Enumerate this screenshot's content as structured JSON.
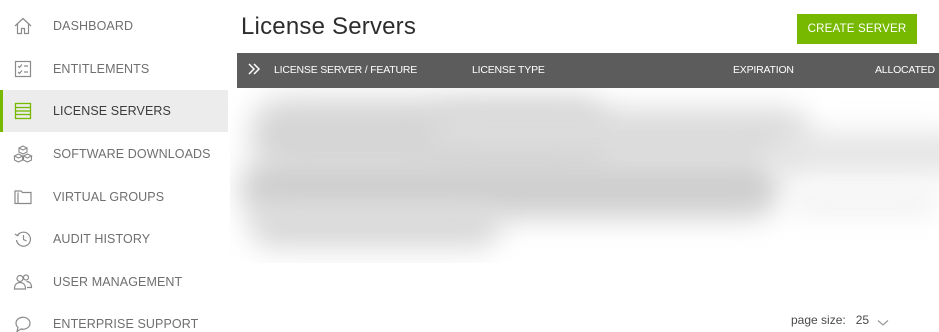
{
  "sidebar": {
    "items": [
      {
        "label": "DASHBOARD",
        "icon": "home-icon"
      },
      {
        "label": "ENTITLEMENTS",
        "icon": "checklist-icon"
      },
      {
        "label": "LICENSE SERVERS",
        "icon": "server-list-icon",
        "active": true
      },
      {
        "label": "SOFTWARE DOWNLOADS",
        "icon": "boxes-icon"
      },
      {
        "label": "VIRTUAL GROUPS",
        "icon": "folder-icon"
      },
      {
        "label": "AUDIT HISTORY",
        "icon": "history-icon"
      },
      {
        "label": "USER MANAGEMENT",
        "icon": "users-icon"
      },
      {
        "label": "ENTERPRISE SUPPORT",
        "icon": "support-chat-icon"
      }
    ]
  },
  "header": {
    "title": "License Servers",
    "create_button": "CREATE SERVER"
  },
  "table": {
    "columns": [
      "LICENSE SERVER / FEATURE",
      "LICENSE TYPE",
      "EXPIRATION",
      "ALLOCATED"
    ]
  },
  "pager": {
    "label": "page size:",
    "value": "25"
  },
  "colors": {
    "accent": "#76b900",
    "header_bg": "#5c5c5c",
    "active_bg": "#ececec"
  }
}
